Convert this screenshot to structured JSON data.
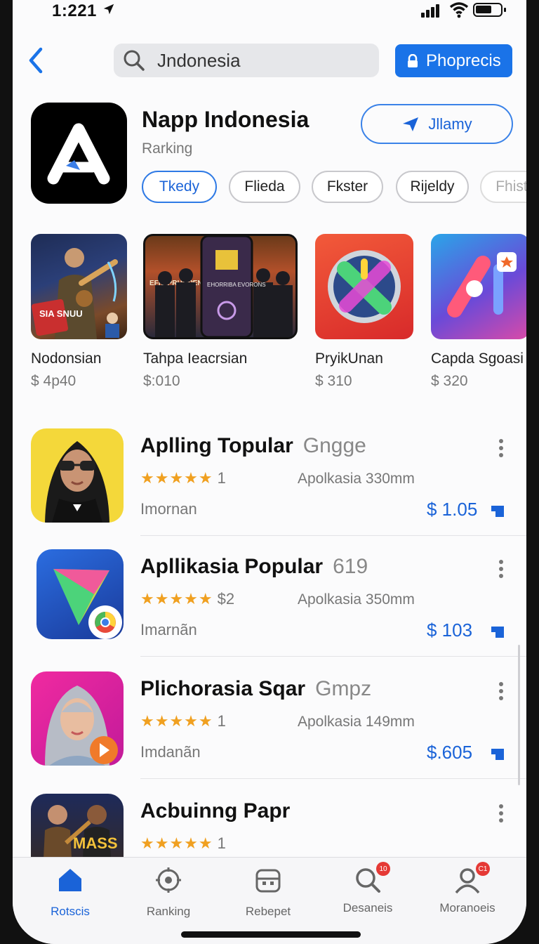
{
  "status": {
    "time": "1:221"
  },
  "search": {
    "value": "Jndonesia"
  },
  "buy_button": {
    "label": "Phoprecis"
  },
  "hero": {
    "title": "Napp Indonesia",
    "subtitle": "Rarking",
    "share_label": "Jllamy"
  },
  "chips": [
    "Tkedy",
    "Flieda",
    "Fkster",
    "Rijeldy",
    "Fhist"
  ],
  "featured": [
    {
      "name": "Nodonsian",
      "price": "$ 4p40",
      "poster_text": "SIA SNUU"
    },
    {
      "name": "Tahpa Ieacrsian",
      "price": "$:010",
      "poster_text": "EFIC PRUMPENCT",
      "phone_text": "EHORRIBA EVORONS"
    },
    {
      "name": "PryikUnan",
      "price": "$ 310"
    },
    {
      "name": "Capda Sgoasi",
      "price": "$  320"
    }
  ],
  "list": [
    {
      "title": "Aplling Topular",
      "extra": "Gngge",
      "stars": "★★★★★",
      "count": "1",
      "meta": "Apolkasia 330mm",
      "dev": "Imornan",
      "price": "$ 1.05"
    },
    {
      "title": "Apllikasia Popular",
      "extra": "619",
      "stars": "★★★★★",
      "count": "$2",
      "meta": "Apolkasia 350mm",
      "dev": "Imarnãn",
      "price": "$ 103"
    },
    {
      "title": "Plichorasia Sqar",
      "extra": "Gmpz",
      "stars": "★★★★★",
      "count": "1",
      "meta": "Apolkasia 149mm",
      "dev": "Imdanãn",
      "price": "$.605"
    },
    {
      "title": "Acbuinng Papr",
      "extra": "",
      "stars": "★★★★★",
      "count": "1",
      "meta": "",
      "dev": "",
      "price": "",
      "poster_text": "MASS"
    }
  ],
  "tabs": [
    {
      "label": "Rotscis",
      "icon": "home-icon"
    },
    {
      "label": "Ranking",
      "icon": "ranking-icon"
    },
    {
      "label": "Rebepet",
      "icon": "apps-icon"
    },
    {
      "label": "Desaneis",
      "icon": "search-icon",
      "badge": "10"
    },
    {
      "label": "Moranoeis",
      "icon": "profile-icon",
      "badge": "C1"
    }
  ],
  "colors": {
    "accent": "#1a73e8",
    "stars": "#f0a020"
  }
}
